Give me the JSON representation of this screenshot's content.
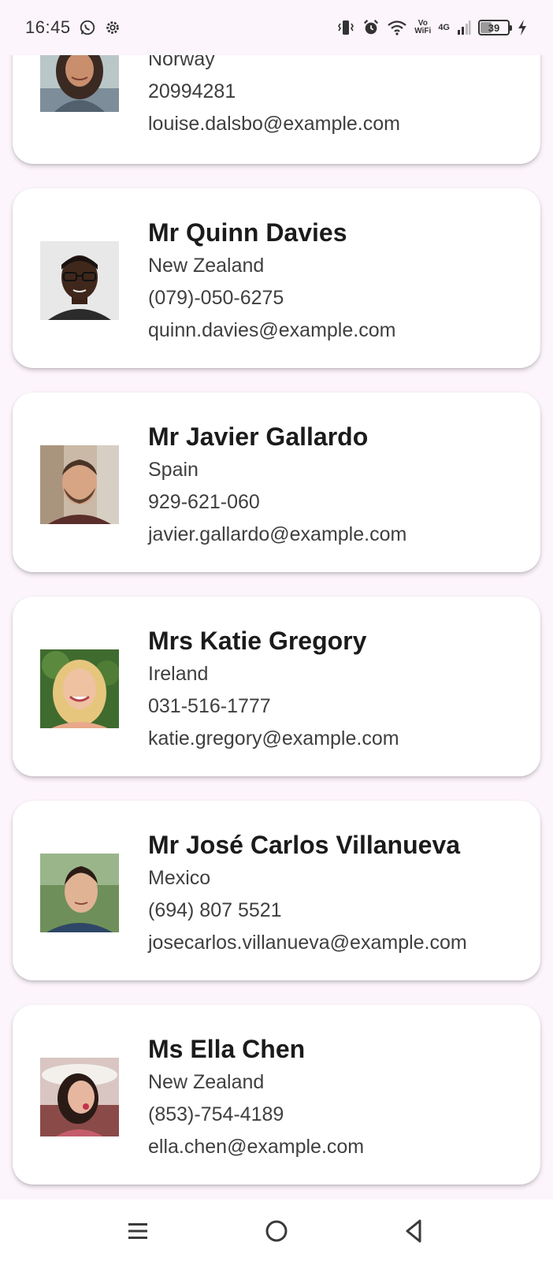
{
  "status_bar": {
    "time": "16:45",
    "network": "4G",
    "volte_top": "Vo",
    "volte_bottom": "WiFi",
    "battery": "39",
    "icons": [
      "whatsapp-icon",
      "settings-icon",
      "vibrate-icon",
      "alarm-icon",
      "wifi-icon",
      "signal-icon",
      "battery-icon",
      "charging-icon"
    ]
  },
  "contacts": [
    {
      "name": "",
      "country": "Norway",
      "phone": "20994281",
      "email": "louise.dalsbo@example.com",
      "avatar": "woman-dark-hair"
    },
    {
      "name": "Mr Quinn Davies",
      "country": "New Zealand",
      "phone": "(079)-050-6275",
      "email": "quinn.davies@example.com",
      "avatar": "man-glasses"
    },
    {
      "name": "Mr Javier Gallardo",
      "country": "Spain",
      "phone": "929-621-060",
      "email": "javier.gallardo@example.com",
      "avatar": "man-beard"
    },
    {
      "name": "Mrs Katie Gregory",
      "country": "Ireland",
      "phone": "031-516-1777",
      "email": "katie.gregory@example.com",
      "avatar": "woman-blonde"
    },
    {
      "name": "Mr José Carlos Villanueva",
      "country": "Mexico",
      "phone": "(694) 807 5521",
      "email": "josecarlos.villanueva@example.com",
      "avatar": "man-short-hair"
    },
    {
      "name": "Ms Ella Chen",
      "country": "New Zealand",
      "phone": "(853)-754-4189",
      "email": "ella.chen@example.com",
      "avatar": "woman-hat"
    }
  ],
  "nav_bar": {
    "buttons": [
      "menu-icon",
      "home-icon",
      "back-icon"
    ]
  }
}
